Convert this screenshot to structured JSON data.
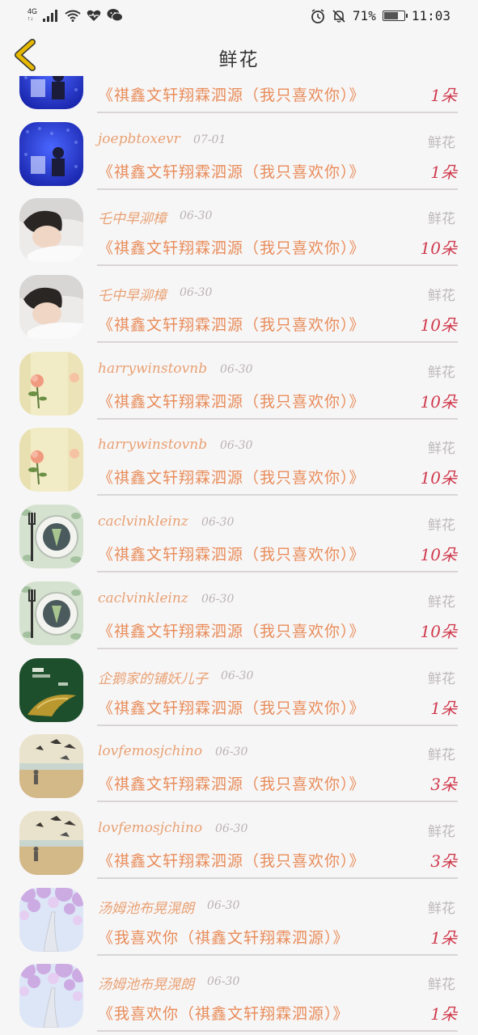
{
  "status": {
    "network": "4G",
    "battery_pct": 71,
    "battery_label": "71%",
    "time": "11:03",
    "icons": [
      "signal-icon",
      "wifi-icon",
      "heart-icon",
      "wechat-icon",
      "alarm-icon",
      "mute-icon",
      "battery-icon"
    ]
  },
  "header": {
    "title": "鲜花",
    "back_icon": "chevron-left-icon",
    "accent": "#e6b800"
  },
  "rows": [
    {
      "name": "",
      "date": "",
      "gift": "",
      "msg": "《祺鑫文轩翔霖泗源（我只喜欢你）》",
      "count": "1朵",
      "avatar": "blue"
    },
    {
      "name": "joepbtoxevr",
      "date": "07-01",
      "gift": "鲜花",
      "msg": "《祺鑫文轩翔霖泗源（我只喜欢你）》",
      "count": "1朵",
      "avatar": "blue"
    },
    {
      "name": "乇中早泖樟",
      "date": "06-30",
      "gift": "鲜花",
      "msg": "《祺鑫文轩翔霖泗源（我只喜欢你）》",
      "count": "10朵",
      "avatar": "boy"
    },
    {
      "name": "乇中早泖樟",
      "date": "06-30",
      "gift": "鲜花",
      "msg": "《祺鑫文轩翔霖泗源（我只喜欢你）》",
      "count": "10朵",
      "avatar": "boy"
    },
    {
      "name": "harrywinstovnb",
      "date": "06-30",
      "gift": "鲜花",
      "msg": "《祺鑫文轩翔霖泗源（我只喜欢你）》",
      "count": "10朵",
      "avatar": "rose"
    },
    {
      "name": "harrywinstovnb",
      "date": "06-30",
      "gift": "鲜花",
      "msg": "《祺鑫文轩翔霖泗源（我只喜欢你）》",
      "count": "10朵",
      "avatar": "rose"
    },
    {
      "name": "caclvinkleinz",
      "date": "06-30",
      "gift": "鲜花",
      "msg": "《祺鑫文轩翔霖泗源（我只喜欢你）》",
      "count": "10朵",
      "avatar": "plate"
    },
    {
      "name": "caclvinkleinz",
      "date": "06-30",
      "gift": "鲜花",
      "msg": "《祺鑫文轩翔霖泗源（我只喜欢你）》",
      "count": "10朵",
      "avatar": "plate"
    },
    {
      "name": "企鹅家的铺妖儿子",
      "date": "06-30",
      "gift": "鲜花",
      "msg": "《祺鑫文轩翔霖泗源（我只喜欢你）》",
      "count": "1朵",
      "avatar": "green"
    },
    {
      "name": "lovfemosjchino",
      "date": "06-30",
      "gift": "鲜花",
      "msg": "《祺鑫文轩翔霖泗源（我只喜欢你）》",
      "count": "3朵",
      "avatar": "beach"
    },
    {
      "name": "lovfemosjchino",
      "date": "06-30",
      "gift": "鲜花",
      "msg": "《祺鑫文轩翔霖泗源（我只喜欢你）》",
      "count": "3朵",
      "avatar": "beach"
    },
    {
      "name": "汤姆池布晃滉朗",
      "date": "06-30",
      "gift": "鲜花",
      "msg": "《我喜欢你（祺鑫文轩翔霖泗源）》",
      "count": "1朵",
      "avatar": "blossom"
    },
    {
      "name": "汤姆池布晃滉朗",
      "date": "06-30",
      "gift": "鲜花",
      "msg": "《我喜欢你（祺鑫文轩翔霖泗源）》",
      "count": "1朵",
      "avatar": "blossom"
    }
  ]
}
